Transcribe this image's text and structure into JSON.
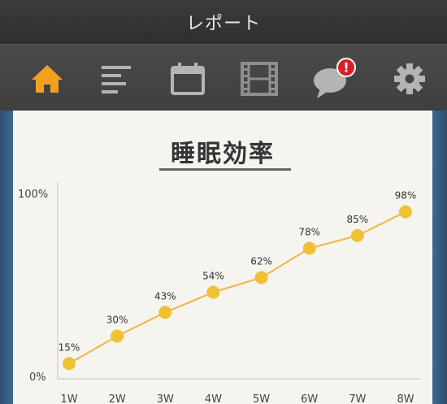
{
  "app": {
    "title": "レポート"
  },
  "toolbar": {
    "items": [
      {
        "name": "home",
        "icon": "home-icon",
        "active": true
      },
      {
        "name": "list",
        "icon": "list-icon",
        "active": false
      },
      {
        "name": "calendar",
        "icon": "calendar-icon",
        "active": false
      },
      {
        "name": "video",
        "icon": "film-icon",
        "active": false
      },
      {
        "name": "messages",
        "icon": "chat-bubble-icon",
        "badge": "!",
        "active": false
      },
      {
        "name": "settings",
        "icon": "gear-icon",
        "active": false
      }
    ]
  },
  "colors": {
    "accent_active": "#f0a21e",
    "icon_inactive": "#b4b4b4",
    "line": "#f2b53f",
    "point": "#efc233",
    "badge": "#d6202a"
  },
  "chart_data": {
    "type": "line",
    "title": "睡眠効率",
    "categories": [
      "1W",
      "2W",
      "3W",
      "4W",
      "5W",
      "6W",
      "7W",
      "8W"
    ],
    "series": [
      {
        "values": [
          15,
          30,
          43,
          54,
          62,
          78,
          85,
          98
        ]
      }
    ],
    "data_labels": [
      "15%",
      "30%",
      "43%",
      "54%",
      "62%",
      "78%",
      "85%",
      "98%"
    ],
    "y_tick_labels": [
      "100%",
      "0%"
    ],
    "ylim": [
      0,
      100
    ],
    "grid": false,
    "legend": "none"
  }
}
